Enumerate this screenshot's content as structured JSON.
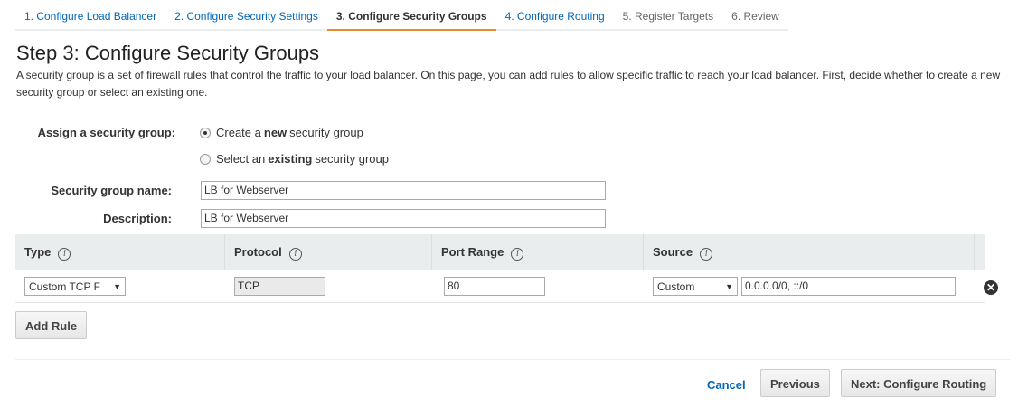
{
  "wizard": {
    "steps": [
      {
        "label": "1. Configure Load Balancer",
        "state": "link"
      },
      {
        "label": "2. Configure Security Settings",
        "state": "link"
      },
      {
        "label": "3. Configure Security Groups",
        "state": "active"
      },
      {
        "label": "4. Configure Routing",
        "state": "link"
      },
      {
        "label": "5. Register Targets",
        "state": "disabled"
      },
      {
        "label": "6. Review",
        "state": "disabled"
      }
    ]
  },
  "page": {
    "title": "Step 3: Configure Security Groups",
    "intro": "A security group is a set of firewall rules that control the traffic to your load balancer. On this page, you can add rules to allow specific traffic to reach your load balancer. First, decide whether to create a new security group or select an existing one."
  },
  "form": {
    "assign_label": "Assign a security group:",
    "option_new": {
      "prefix": "Create a",
      "bold": "new",
      "suffix": "security group",
      "selected": true
    },
    "option_existing": {
      "prefix": "Select an",
      "bold": "existing",
      "suffix": "security group",
      "selected": false
    },
    "name_label": "Security group name:",
    "name_value": "LB for Webserver",
    "description_label": "Description:",
    "description_value": "LB for Webserver"
  },
  "rules_table": {
    "headers": {
      "type": "Type",
      "protocol": "Protocol",
      "port_range": "Port Range",
      "source": "Source"
    },
    "info_glyph": "i",
    "rows": [
      {
        "type": "Custom TCP F",
        "protocol": "TCP",
        "port_range": "80",
        "source_type": "Custom",
        "source_value": "0.0.0.0/0, ::/0"
      }
    ],
    "remove_glyph": "✕"
  },
  "actions": {
    "add_rule": "Add Rule",
    "cancel": "Cancel",
    "previous": "Previous",
    "next": "Next: Configure Routing"
  },
  "colors": {
    "link": "#0066bb",
    "active_tab_underline": "#e78a2d",
    "table_header_bg": "#eaeded"
  }
}
